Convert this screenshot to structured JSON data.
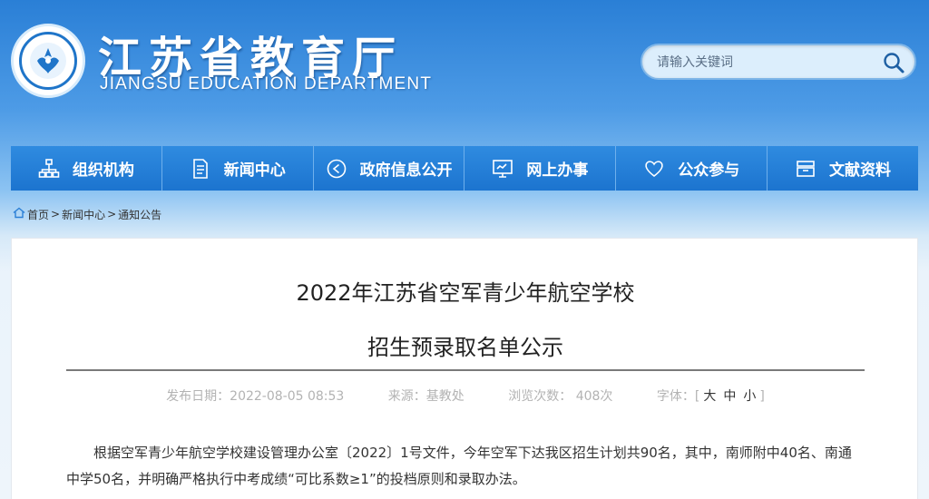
{
  "header": {
    "title_cn": "江苏省教育厅",
    "title_en": "JIANGSU EDUCATION DEPARTMENT",
    "search_placeholder": "请输入关键词"
  },
  "nav": [
    {
      "label": "组织机构",
      "icon": "org-chart-icon"
    },
    {
      "label": "新闻中心",
      "icon": "document-icon"
    },
    {
      "label": "政府信息公开",
      "icon": "announcement-icon"
    },
    {
      "label": "网上办事",
      "icon": "monitor-icon"
    },
    {
      "label": "公众参与",
      "icon": "heart-icon"
    },
    {
      "label": "文献资料",
      "icon": "archive-icon"
    }
  ],
  "breadcrumb": {
    "home": "首页",
    "sep1": ">",
    "news": "新闻中心",
    "sep2": ">",
    "notice": "通知公告"
  },
  "article": {
    "title_line1": "2022年江苏省空军青少年航空学校",
    "title_line2": "招生预录取名单公示",
    "published": "发布日期：2022-08-05 08:53",
    "source": "来源：基教处",
    "views": "浏览次数：  408次",
    "font_label": "字体：[",
    "font_large": "大",
    "font_medium": "中",
    "font_small": "小",
    "font_close": "]",
    "paragraph": "根据空军青少年航空学校建设管理办公室〔2022〕1号文件，今年空军下达我区招生计划共90名，其中，南师附中40名、南通中学50名，并明确严格执行中考成绩“可比系数≥1”的投档原则和录取办法。"
  },
  "colors": {
    "header_blue": "#2a7fd6",
    "nav_blue": "#1c74cf",
    "meta_gray": "#b3b3b3"
  }
}
